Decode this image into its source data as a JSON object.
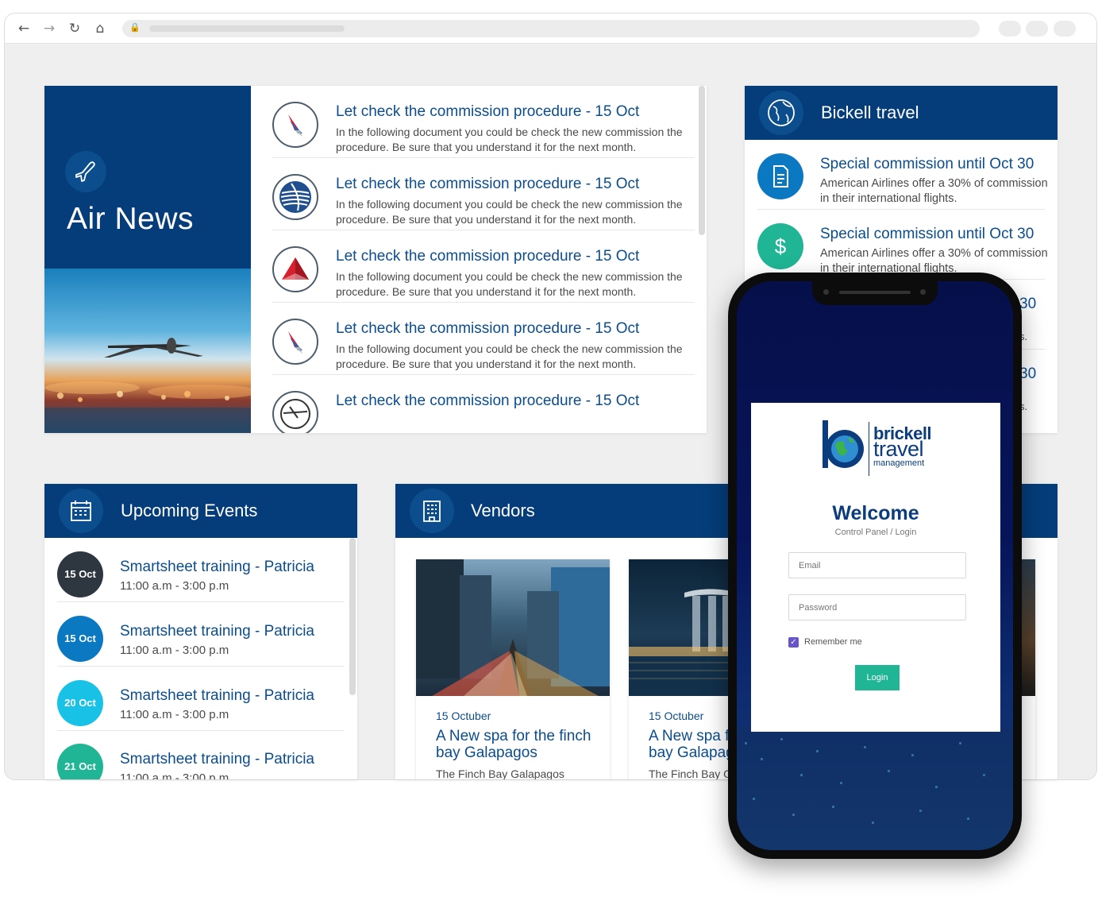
{
  "colors": {
    "primary_blue": "#043d7a",
    "link_blue": "#0b4d8d",
    "teal": "#1fb595",
    "cyan": "#18c2e6",
    "dark_badge": "#2e3740",
    "mid_blue_badge": "#0b78c2"
  },
  "air_news": {
    "title": "Air News",
    "icon": "plane-icon",
    "items": [
      {
        "title": "Let check the commission procedure  -  15 Oct",
        "desc": "In the following document you could be check the new commission the procedure. Be sure that you understand it for the next month.",
        "logo": "american-airlines-logo"
      },
      {
        "title": "Let check the commission procedure  -  15 Oct",
        "desc": "In the following document you could be check the new commission the procedure. Be sure that you understand it for the next month.",
        "logo": "united-airlines-logo"
      },
      {
        "title": "Let check the commission procedure  -  15 Oct",
        "desc": "In the following document you could be check the new commission the procedure. Be sure that you understand it for the next month.",
        "logo": "delta-airlines-logo"
      },
      {
        "title": "Let check the commission procedure  -  15 Oct",
        "desc": "In the following document you could be check the new commission the procedure. Be sure that you understand it for the next month.",
        "logo": "american-airlines-logo"
      },
      {
        "title": "Let check the commission procedure  -  15 Oct",
        "desc": "",
        "logo": "lufthansa-logo"
      }
    ]
  },
  "bickell": {
    "title": "Bickell travel",
    "icon": "globe-icon",
    "items": [
      {
        "title": "Special commission until Oct 30",
        "desc": "American Airlines offer a 30% of commission in their international flights.",
        "icon": "document-icon",
        "color": "#0b78c2"
      },
      {
        "title": "Special commission until Oct 30",
        "desc": "American Airlines offer a 30% of commission in their international flights.",
        "icon": "dollar-icon",
        "color": "#1fb595"
      },
      {
        "title_tail": "30",
        "desc_tail": "s."
      },
      {
        "title_tail": "30",
        "desc_tail": "s."
      }
    ]
  },
  "events": {
    "title": "Upcoming Events",
    "icon": "calendar-icon",
    "items": [
      {
        "date": "15 Oct",
        "title": "Smartsheet training  -  Patricia",
        "time": "11:00 a.m  -  3:00 p.m",
        "color": "#2e3740"
      },
      {
        "date": "15 Oct",
        "title": "Smartsheet training  -  Patricia",
        "time": "11:00 a.m  -  3:00 p.m",
        "color": "#0b78c2"
      },
      {
        "date": "20 Oct",
        "title": "Smartsheet training  -  Patricia",
        "time": "11:00 a.m  -  3:00 p.m",
        "color": "#18c2e6"
      },
      {
        "date": "21 Oct",
        "title": "Smartsheet training  -  Patricia",
        "time": "11:00 a.m  -  3:00 p.m",
        "color": "#1fb595"
      }
    ]
  },
  "vendors": {
    "title": "Vendors",
    "icon": "building-icon",
    "items": [
      {
        "date": "15 Octuber",
        "title": "A New spa for the finch bay Galapagos",
        "text": "The Finch Bay Galapagos"
      },
      {
        "date": "15 Octuber",
        "title": "A New spa for the finch bay Galapagos",
        "text": "The Finch Bay Galapagos"
      }
    ]
  },
  "login": {
    "brand_line1": "brickell",
    "brand_line2": "travel",
    "brand_line3": "management",
    "welcome": "Welcome",
    "subtitle": "Control Panel / Login",
    "email_placeholder": "Email",
    "password_placeholder": "Password",
    "remember_label": "Remember me",
    "remember_checked": true,
    "login_button": "Login"
  }
}
